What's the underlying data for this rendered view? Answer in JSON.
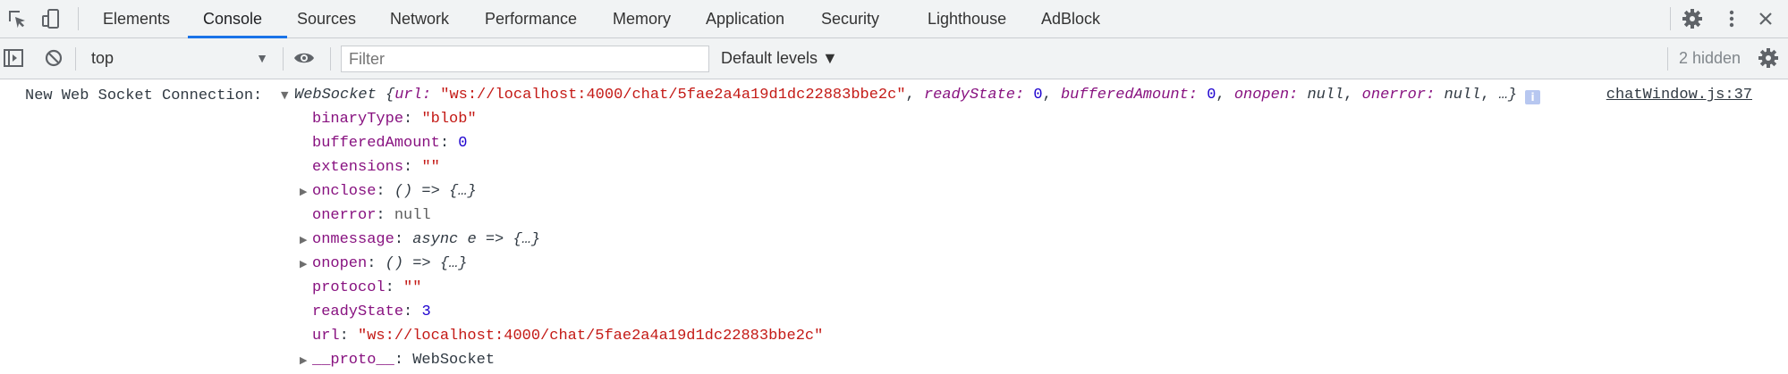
{
  "tabs": [
    {
      "label": "Elements",
      "active": false
    },
    {
      "label": "Console",
      "active": true
    },
    {
      "label": "Sources",
      "active": false
    },
    {
      "label": "Network",
      "active": false
    },
    {
      "label": "Performance",
      "active": false
    },
    {
      "label": "Memory",
      "active": false
    },
    {
      "label": "Application",
      "active": false
    },
    {
      "label": "Security",
      "active": false
    },
    {
      "label": "Lighthouse",
      "active": false
    },
    {
      "label": "AdBlock",
      "active": false
    }
  ],
  "toolbar": {
    "context_value": "top",
    "filter_placeholder": "Filter",
    "filter_value": "",
    "levels_label": "Default levels ▼",
    "hidden_count": "2 hidden"
  },
  "message": {
    "label": "New Web Socket Connection:",
    "source": "chatWindow.js:37",
    "summary": {
      "type": "WebSocket",
      "url_key": "url:",
      "url_value": "\"ws://localhost:4000/chat/5fae2a4a19d1dc22883bbe2c\"",
      "readyState_key": "readyState:",
      "readyState_value": "0",
      "bufferedAmount_key": "bufferedAmount:",
      "bufferedAmount_value": "0",
      "onopen_key": "onopen:",
      "onopen_value": "null",
      "onerror_key": "onerror:",
      "onerror_value": "null",
      "ellipsis": "…}"
    },
    "properties": [
      {
        "key": "binaryType",
        "value": "\"blob\""
      },
      {
        "key": "bufferedAmount",
        "value": "0"
      },
      {
        "key": "extensions",
        "value": "\"\""
      },
      {
        "key": "onclose",
        "value": "() => {…}"
      },
      {
        "key": "onerror",
        "value": "null"
      },
      {
        "key": "onmessage",
        "value": "async e => {…}"
      },
      {
        "key": "onopen",
        "value": "() => {…}"
      },
      {
        "key": "protocol",
        "value": "\"\""
      },
      {
        "key": "readyState",
        "value": "3"
      },
      {
        "key": "url",
        "value": "\"ws://localhost:4000/chat/5fae2a4a19d1dc22883bbe2c\""
      },
      {
        "key": "__proto__",
        "value": "WebSocket"
      }
    ]
  },
  "colors": {
    "accent": "#1a73e8",
    "property_key": "#881280",
    "string": "#c41a16",
    "number": "#1c00cf"
  }
}
